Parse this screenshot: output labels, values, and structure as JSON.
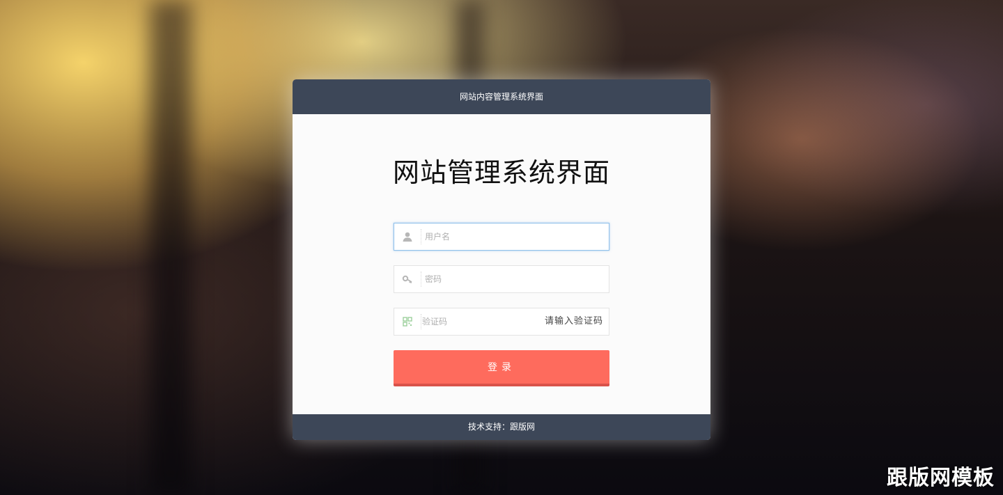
{
  "header": {
    "title": "网站内容管理系统界面"
  },
  "main": {
    "heading": "网站管理系统界面"
  },
  "form": {
    "username": {
      "placeholder": "用户名",
      "value": "",
      "icon": "user-icon"
    },
    "password": {
      "placeholder": "密码",
      "value": "",
      "icon": "key-icon"
    },
    "captcha": {
      "placeholder": "验证码",
      "value": "",
      "icon": "qrcode-icon",
      "hint": "请输入验证码"
    },
    "submit_label": "登录"
  },
  "footer": {
    "text": "技术支持：跟版网"
  },
  "watermark": {
    "text": "跟版网模板"
  },
  "colors": {
    "header_bg": "#3d4758",
    "button_bg": "#fe6b5d",
    "button_shadow": "#d9524a",
    "focus_border": "#8fc0ea"
  }
}
